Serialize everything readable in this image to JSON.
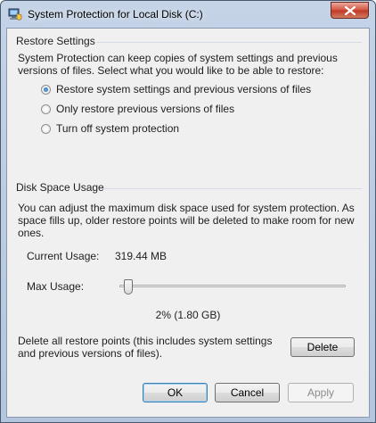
{
  "window": {
    "title": "System Protection for Local Disk (C:)",
    "app_icon": "system-protection-icon",
    "close_icon": "close-icon"
  },
  "restore_settings": {
    "header": "Restore Settings",
    "description_lines": [
      "System Protection can keep copies of system settings and previous",
      "versions of files. Select what you would like to be able to restore:"
    ],
    "options": [
      {
        "label": "Restore system settings and previous versions of files",
        "checked": true
      },
      {
        "label": "Only restore previous versions of files",
        "checked": false
      },
      {
        "label": "Turn off system protection",
        "checked": false
      }
    ]
  },
  "disk_space": {
    "header": "Disk Space Usage",
    "description_lines": [
      "You can adjust the maximum disk space used for system protection. As",
      "space fills up, older restore points will be deleted to make room for new",
      "ones."
    ],
    "current_usage_label": "Current Usage:",
    "current_usage_value": "319.44 MB",
    "max_usage_label": "Max Usage:",
    "max_usage_fraction": 0.02,
    "max_usage_text": "2% (1.80 GB)",
    "delete_text_lines": [
      "Delete all restore points (this includes system settings",
      "and previous versions of files)."
    ],
    "delete_button": "Delete"
  },
  "footer": {
    "ok": "OK",
    "cancel": "Cancel",
    "apply": "Apply"
  },
  "colors": {
    "titlebar": "#b9cbe2",
    "close_button": "#c9462f",
    "client_bg": "#f0f0f0",
    "radio_selected": "#1a5aa6"
  }
}
